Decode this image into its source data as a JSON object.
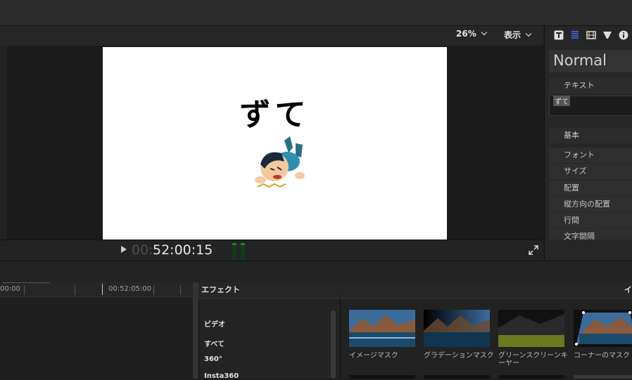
{
  "viewer": {
    "zoom": "26%",
    "view_menu": "表示",
    "canvas_text": "ずて",
    "timecode_dim": "00:",
    "timecode": "52:00:15"
  },
  "inspector": {
    "style": "Normal",
    "section_text": "テキスト",
    "text_value": "ずて",
    "section_basic": "基本",
    "props": [
      "フォント",
      "サイズ",
      "配置",
      "縦方向の配置",
      "行間",
      "文字間隔"
    ]
  },
  "timeline": {
    "ruler_start": "00:00",
    "ruler_mark": "00:52:05:00"
  },
  "effects": {
    "title": "エフェクト",
    "categories": [
      "ビデオ",
      "すべて",
      "360°",
      "Insta360"
    ]
  },
  "browser": {
    "header": "イ",
    "items": [
      "イメージマスク",
      "グラデーションマスク",
      "グリーンスクリーンキーヤー",
      "コーナーのマスク"
    ]
  },
  "icons": [
    "text-inspector-icon",
    "paragraph-icon",
    "video-icon",
    "filter-icon",
    "info-icon",
    "play-icon",
    "fullscreen-icon"
  ],
  "colors": {
    "accent": "#4a6cf7",
    "canvas": "#ffffff",
    "meter_green": "#2a7a3a"
  }
}
